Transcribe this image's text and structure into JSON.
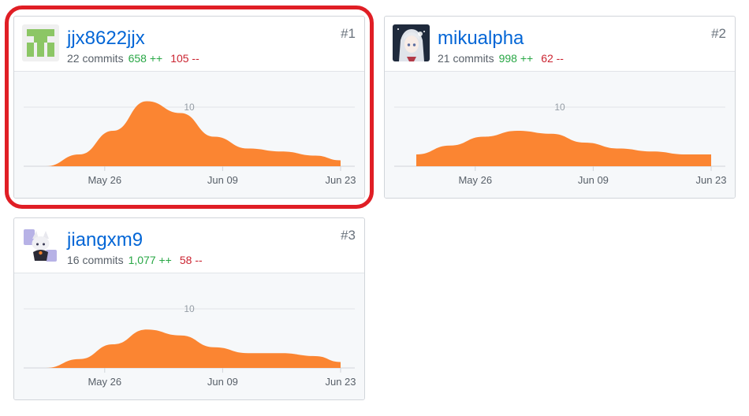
{
  "contributors": [
    {
      "rank": "#1",
      "username": "jjx8622jjx",
      "commits": "22 commits",
      "additions": "658 ++",
      "deletions": "105 --",
      "avatar_icon": "identicon-avatar",
      "highlighted": true
    },
    {
      "rank": "#2",
      "username": "mikualpha",
      "commits": "21 commits",
      "additions": "998 ++",
      "deletions": "62 --",
      "avatar_icon": "anime-girl-avatar",
      "highlighted": false
    },
    {
      "rank": "#3",
      "username": "jiangxm9",
      "commits": "16 commits",
      "additions": "1,077 ++",
      "deletions": "58 --",
      "avatar_icon": "anime-character-avatar",
      "highlighted": false
    }
  ],
  "chart_data": [
    {
      "type": "area",
      "title": "",
      "x": [
        "May 19",
        "May 23",
        "May 27",
        "May 31",
        "Jun 04",
        "Jun 08",
        "Jun 12",
        "Jun 16",
        "Jun 20",
        "Jun 23"
      ],
      "values": [
        0,
        2,
        6,
        11,
        9,
        5,
        3,
        2.5,
        1.8,
        1
      ],
      "x_ticks": [
        "May 26",
        "Jun 09",
        "Jun 23"
      ],
      "y_ticks": [
        10
      ],
      "ylim": [
        0,
        12
      ],
      "color": "#fb8532"
    },
    {
      "type": "area",
      "title": "",
      "x": [
        "May 19",
        "May 23",
        "May 27",
        "May 31",
        "Jun 04",
        "Jun 08",
        "Jun 12",
        "Jun 16",
        "Jun 20",
        "Jun 23"
      ],
      "values": [
        2,
        3.5,
        5,
        6,
        5.5,
        4,
        3,
        2.5,
        2,
        2
      ],
      "x_ticks": [
        "May 26",
        "Jun 09",
        "Jun 23"
      ],
      "y_ticks": [
        10
      ],
      "ylim": [
        0,
        12
      ],
      "color": "#fb8532"
    },
    {
      "type": "area",
      "title": "",
      "x": [
        "May 19",
        "May 23",
        "May 27",
        "May 31",
        "Jun 04",
        "Jun 08",
        "Jun 12",
        "Jun 16",
        "Jun 20",
        "Jun 23"
      ],
      "values": [
        0,
        1.5,
        4,
        6.5,
        5.5,
        3.5,
        2.5,
        2.5,
        2,
        1
      ],
      "x_ticks": [
        "May 26",
        "Jun 09",
        "Jun 23"
      ],
      "y_ticks": [
        10
      ],
      "ylim": [
        0,
        12
      ],
      "color": "#fb8532"
    }
  ]
}
